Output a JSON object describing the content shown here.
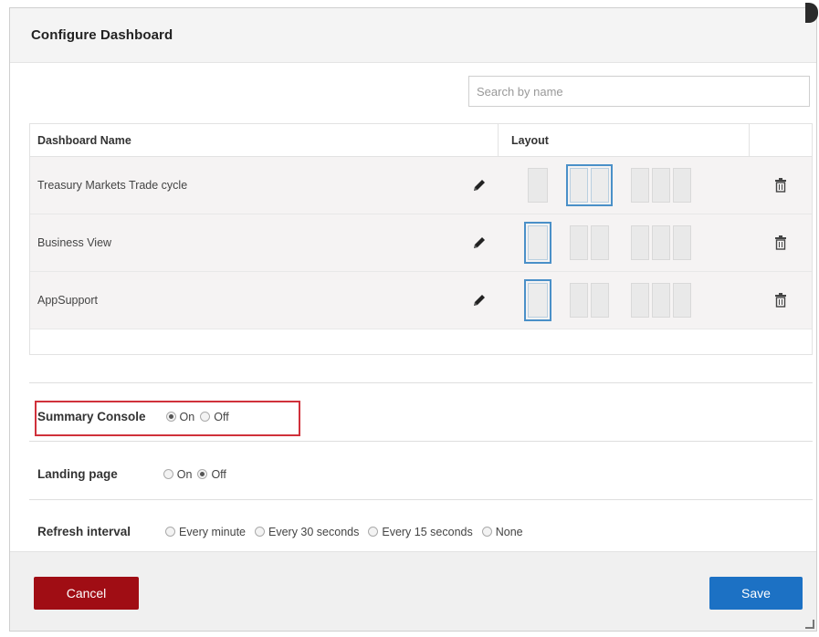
{
  "dialog": {
    "title": "Configure Dashboard"
  },
  "search": {
    "placeholder": "Search by name"
  },
  "table": {
    "headers": {
      "name": "Dashboard Name",
      "layout": "Layout"
    },
    "rows": [
      {
        "name": "Treasury Markets Trade cycle",
        "selected_layout": 2
      },
      {
        "name": "Business View",
        "selected_layout": 1
      },
      {
        "name": "AppSupport",
        "selected_layout": 1
      }
    ],
    "icons": {
      "edit": "pencil-icon",
      "delete": "trash-icon"
    }
  },
  "settings": {
    "summary_console": {
      "label": "Summary Console",
      "on": "On",
      "off": "Off",
      "selected": "On"
    },
    "landing_page": {
      "label": "Landing page",
      "on": "On",
      "off": "Off",
      "selected": "Off"
    },
    "refresh_interval": {
      "label": "Refresh interval",
      "options": [
        "Every minute",
        "Every 30 seconds",
        "Every 15 seconds",
        "None"
      ],
      "selected": null
    }
  },
  "footer": {
    "cancel_label": "Cancel",
    "save_label": "Save"
  },
  "colors": {
    "cancel": "#a00d14",
    "save": "#1c71c4",
    "highlight": "#d0313b",
    "layout_selected": "#4a90c8"
  }
}
